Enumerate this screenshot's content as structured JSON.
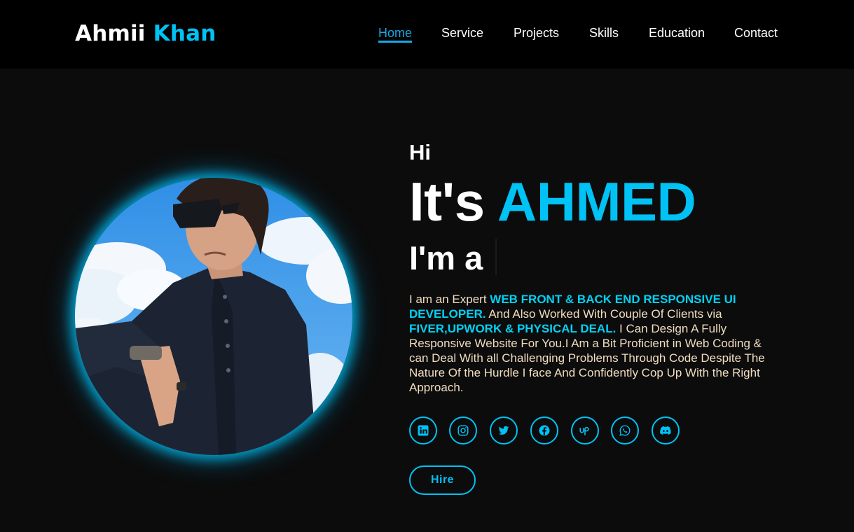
{
  "header": {
    "logo_first": "Ahmii",
    "logo_second": "Khan",
    "nav": [
      {
        "label": "Home",
        "active": true
      },
      {
        "label": "Service",
        "active": false
      },
      {
        "label": "Projects",
        "active": false
      },
      {
        "label": "Skills",
        "active": false
      },
      {
        "label": "Education",
        "active": false
      },
      {
        "label": "Contact",
        "active": false
      }
    ]
  },
  "hero": {
    "greeting": "Hi",
    "intro_prefix": "It's",
    "intro_name": "AHMED",
    "role_prefix": "I'm a",
    "description": {
      "p1": "I am an Expert ",
      "h1": "WEB FRONT & BACK END RESPONSIVE UI DEVELOPER.",
      "p2": " And Also Worked With Couple Of Clients via ",
      "h2": "FIVER,UPWORK & PHYSICAL DEAL.",
      "p3": " I Can Design A Fully Responsive Website For You.I Am a Bit Proficient in Web Coding & can Deal With all Challenging Problems Through Code Despite The Nature Of the Hurdle I face And Confidently Cop Up With the Right Approach."
    },
    "social_icons": [
      "linkedin-icon",
      "instagram-icon",
      "twitter-icon",
      "facebook-icon",
      "upwork-icon",
      "whatsapp-icon",
      "discord-icon"
    ],
    "hire_label": "Hire"
  },
  "colors": {
    "accent": "#00c2f5",
    "background": "#0c0c0c",
    "header_bg": "#000000",
    "description_text": "#f1dcc0"
  }
}
